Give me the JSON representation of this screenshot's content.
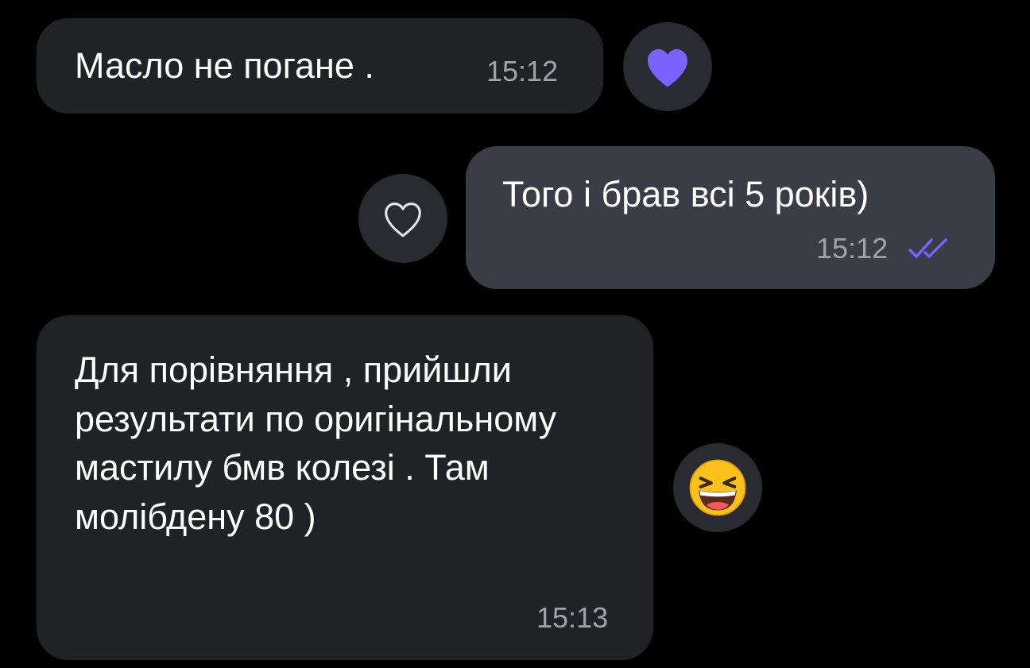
{
  "messages": [
    {
      "direction": "incoming",
      "text": "Масло не погане .",
      "time": "15:12",
      "reaction": "purple-heart-icon"
    },
    {
      "direction": "outgoing",
      "text": "Того і брав всі 5 років)",
      "time": "15:12",
      "status": "read-double-check-icon",
      "reaction": "outline-heart-icon"
    },
    {
      "direction": "incoming",
      "text": "Для порівняння , прийшли результати по оригінальному мастилу бмв колезі . Там молібдену 80 )",
      "time": "15:13",
      "reaction": "grinning-squinting-face-emoji"
    }
  ],
  "colors": {
    "background": "#000000",
    "incoming_bubble": "#212226",
    "outgoing_bubble": "#3a3d45",
    "timestamp": "#a1a3a8",
    "accent_purple": "#7b61ff",
    "reaction_bg": "#2a2b30"
  }
}
